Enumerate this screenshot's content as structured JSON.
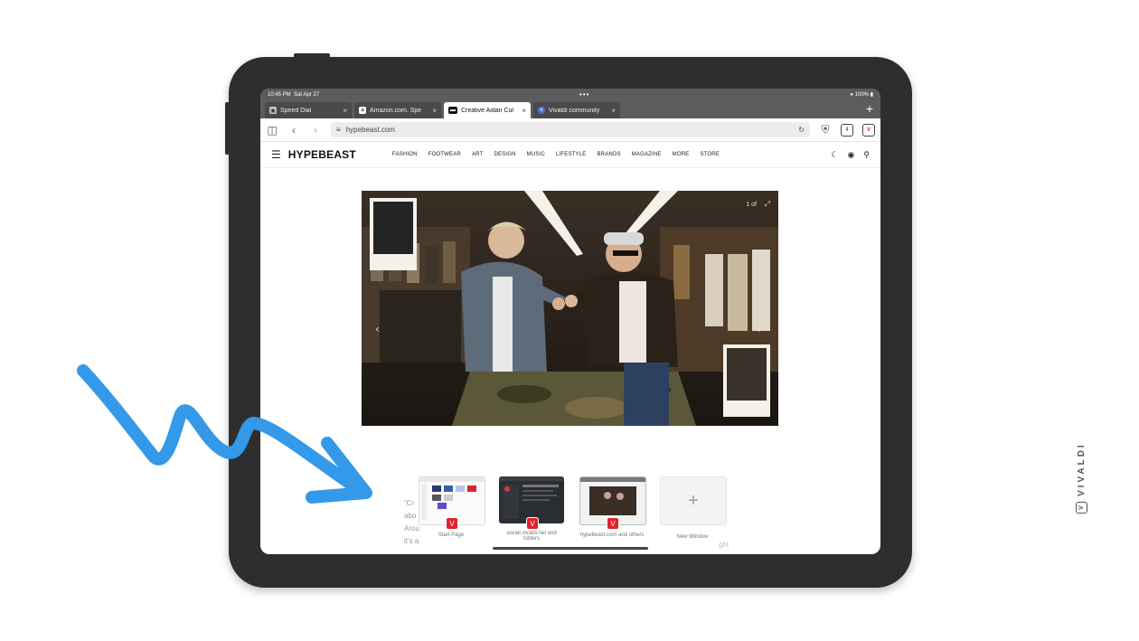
{
  "statusbar": {
    "time": "10:45 PM",
    "date": "Sat Apr 27",
    "center_dots": "•••",
    "battery": "100%"
  },
  "tabs": [
    {
      "title": "Speed Dial",
      "active": false
    },
    {
      "title": "Amazon.com. Spe",
      "active": false
    },
    {
      "title": "Creative Aidan Cul",
      "active": true
    },
    {
      "title": "Vivaldi community",
      "active": false
    }
  ],
  "toolbar": {
    "url": "hypebeast.com",
    "tab_count": "4",
    "new_tab": "+",
    "reload": "↻"
  },
  "site": {
    "logo": "HYPEBEAST",
    "nav": [
      "FASHION",
      "FOOTWEAR",
      "ART",
      "DESIGN",
      "MUSIC",
      "LIFESTYLE",
      "BRANDS",
      "MAGAZINE",
      "MORE",
      "STORE"
    ]
  },
  "hero": {
    "counter": "1 of"
  },
  "caption": {
    "lines": [
      "“Cr",
      "abo",
      "Arou",
      "it’s a"
    ],
    "right_fragment": "ght"
  },
  "switcher": [
    {
      "label": "Start Page"
    },
    {
      "label": "social.vivaldi.net and folders"
    },
    {
      "label": "hypebeast.com and others"
    },
    {
      "label": "New Window"
    }
  ],
  "brand": {
    "vertical_text": "VIVALDI"
  },
  "colors": {
    "arrow": "#3399e8",
    "vivaldi_red": "#e0222e",
    "device": "#2e2e30"
  }
}
